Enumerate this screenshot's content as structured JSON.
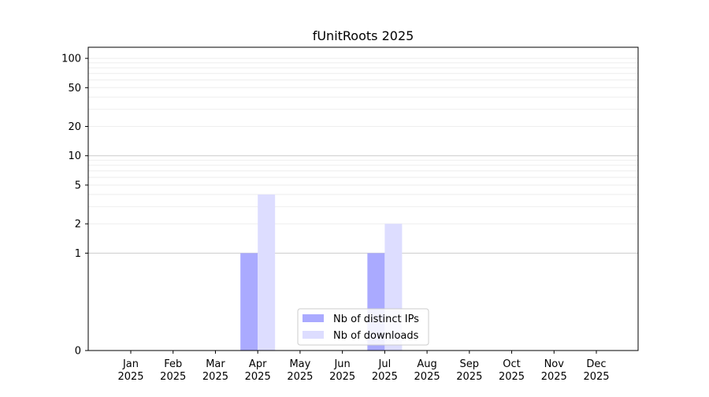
{
  "chart_data": {
    "type": "bar",
    "title": "fUnitRoots 2025",
    "xlabel": "",
    "ylabel": "",
    "categories": [
      [
        "Jan",
        "2025"
      ],
      [
        "Feb",
        "2025"
      ],
      [
        "Mar",
        "2025"
      ],
      [
        "Apr",
        "2025"
      ],
      [
        "May",
        "2025"
      ],
      [
        "Jun",
        "2025"
      ],
      [
        "Jul",
        "2025"
      ],
      [
        "Aug",
        "2025"
      ],
      [
        "Sep",
        "2025"
      ],
      [
        "Oct",
        "2025"
      ],
      [
        "Nov",
        "2025"
      ],
      [
        "Dec",
        "2025"
      ]
    ],
    "series": [
      {
        "name": "Nb of distinct IPs",
        "color": "#aaaaff",
        "values": [
          0,
          0,
          0,
          1,
          0,
          0,
          1,
          0,
          0,
          0,
          0,
          0
        ]
      },
      {
        "name": "Nb of downloads",
        "color": "#ddddff",
        "values": [
          0,
          0,
          0,
          4,
          0,
          0,
          2,
          0,
          0,
          0,
          0,
          0
        ]
      }
    ],
    "yscale": "symlog",
    "ylim": [
      0,
      130
    ],
    "yticks": [
      0,
      1,
      2,
      5,
      10,
      20,
      50,
      100
    ],
    "grid": true,
    "legend": "bottom-center"
  }
}
